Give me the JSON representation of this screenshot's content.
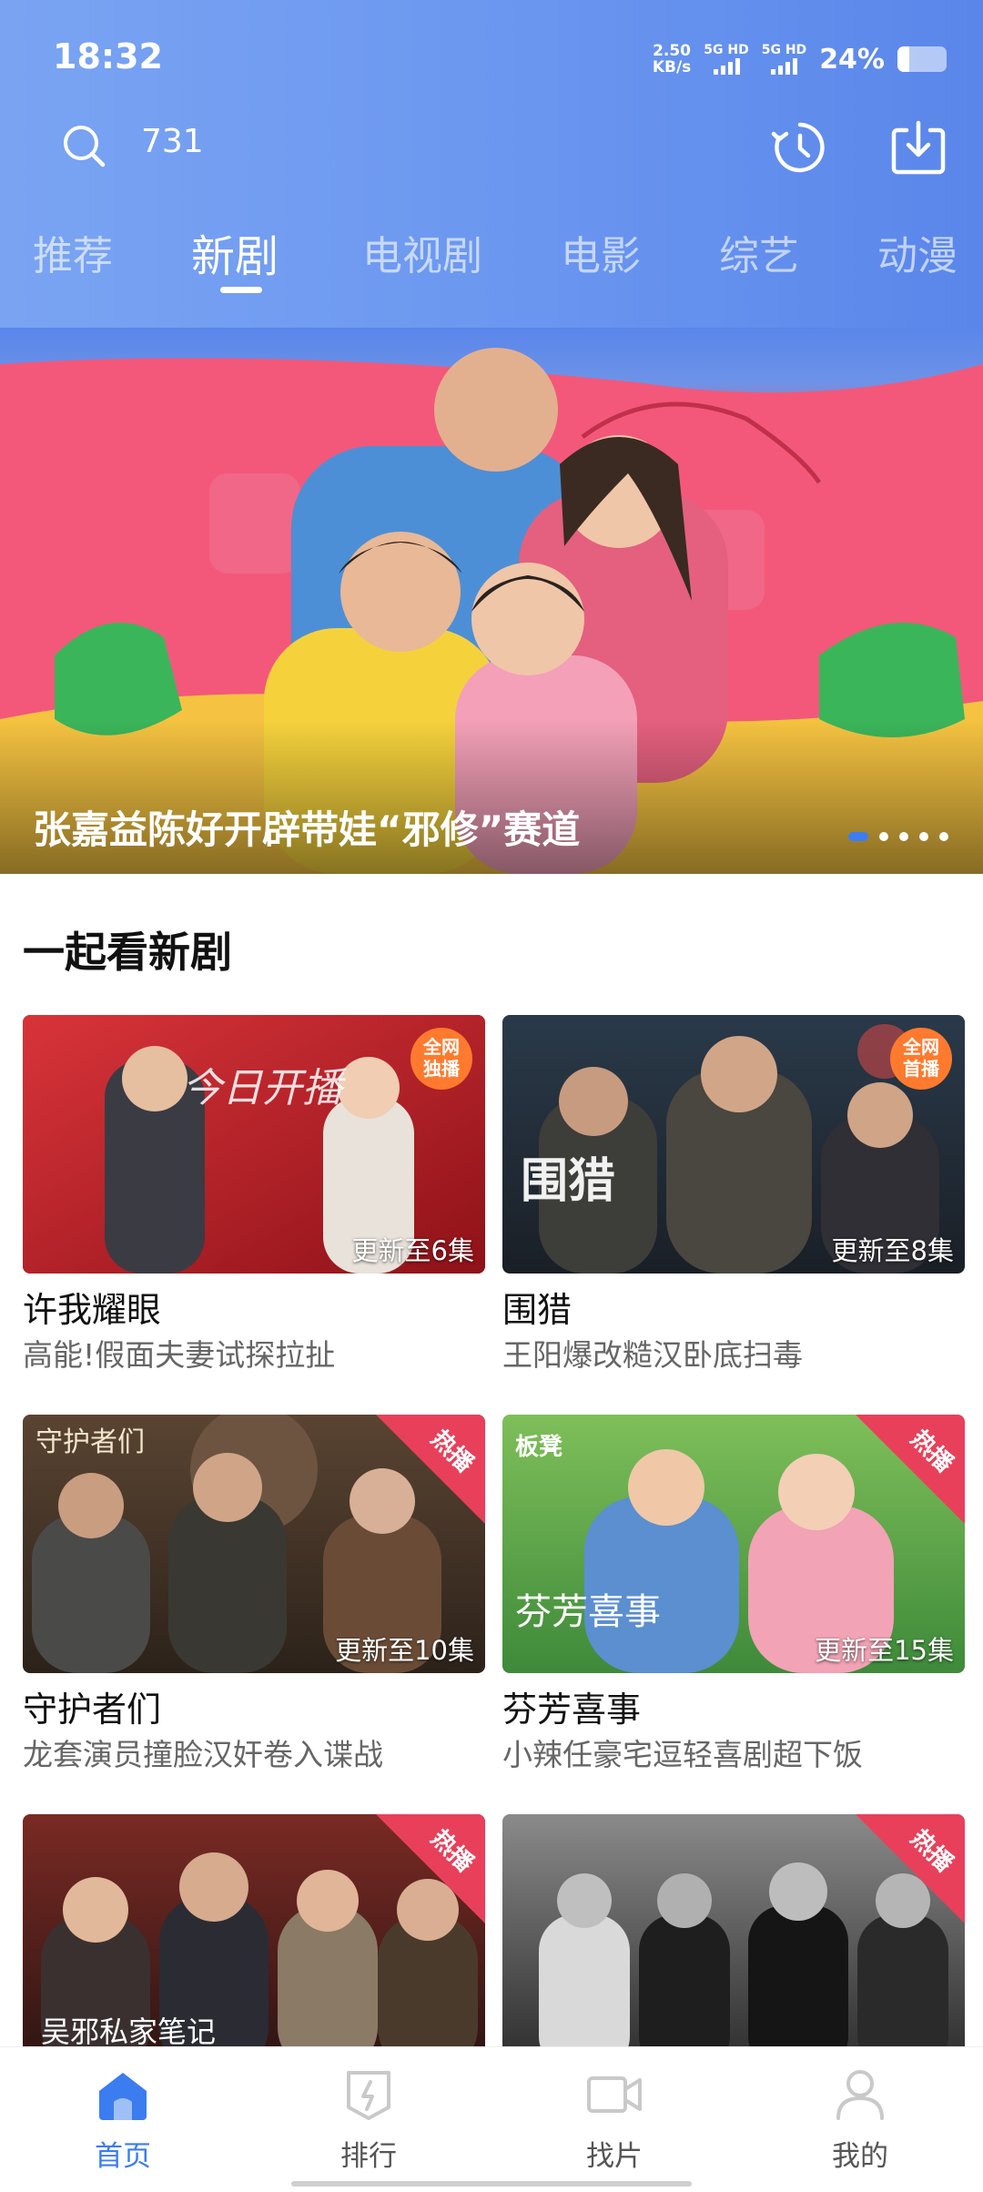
{
  "status_bar": {
    "time": "18:32",
    "net_speed_value": "2.50",
    "net_speed_unit": "KB/s",
    "signal_1": "5G HD",
    "signal_2": "5G HD",
    "battery": "24%"
  },
  "search": {
    "query": "731",
    "icon": "search-icon"
  },
  "header_icons": [
    "history-icon",
    "download-icon"
  ],
  "tabs": [
    {
      "label": "推荐",
      "active": false
    },
    {
      "label": "新剧",
      "active": true
    },
    {
      "label": "电视剧",
      "active": false
    },
    {
      "label": "电影",
      "active": false
    },
    {
      "label": "综艺",
      "active": false
    },
    {
      "label": "动漫",
      "active": false
    }
  ],
  "banner": {
    "title": "张嘉益陈好开辟带娃“邪修”赛道",
    "dots_total": 5,
    "dots_active": 0
  },
  "section": {
    "title": "一起看新剧"
  },
  "cards": [
    {
      "title": "许我耀眼",
      "subtitle": "高能!假面夫妻试探拉扯",
      "episode": "更新至6集",
      "corner": "全网独播",
      "poster_text": "今日开播"
    },
    {
      "title": "围猎",
      "subtitle": "王阳爆改糙汉卧底扫毒",
      "episode": "更新至8集",
      "corner": "全网首播",
      "poster_text": "围猎"
    },
    {
      "title": "守护者们",
      "subtitle": "龙套演员撞脸汉奸卷入谍战",
      "episode": "更新至10集",
      "corner": "热播",
      "poster_text": "守护者们"
    },
    {
      "title": "芬芳喜事",
      "subtitle": "小辣任豪宅逗轻喜剧超下饭",
      "episode": "更新至15集",
      "corner": "热播",
      "poster_text": "芬芳喜事"
    },
    {
      "title": "",
      "subtitle": "",
      "episode": "",
      "corner": "热播",
      "poster_text": "吴邪私家笔记"
    },
    {
      "title": "",
      "subtitle": "",
      "episode": "",
      "corner": "热播",
      "poster_text": ""
    }
  ],
  "bottom_nav": [
    {
      "label": "首页",
      "icon": "home-icon",
      "active": true
    },
    {
      "label": "排行",
      "icon": "ranking-icon",
      "active": false
    },
    {
      "label": "找片",
      "icon": "video-camera-icon",
      "active": false
    },
    {
      "label": "我的",
      "icon": "profile-icon",
      "active": false
    }
  ],
  "colors": {
    "header_blue": "#6a96f0",
    "accent_blue": "#3b7cf0",
    "hot_badge": "#e8405a"
  }
}
